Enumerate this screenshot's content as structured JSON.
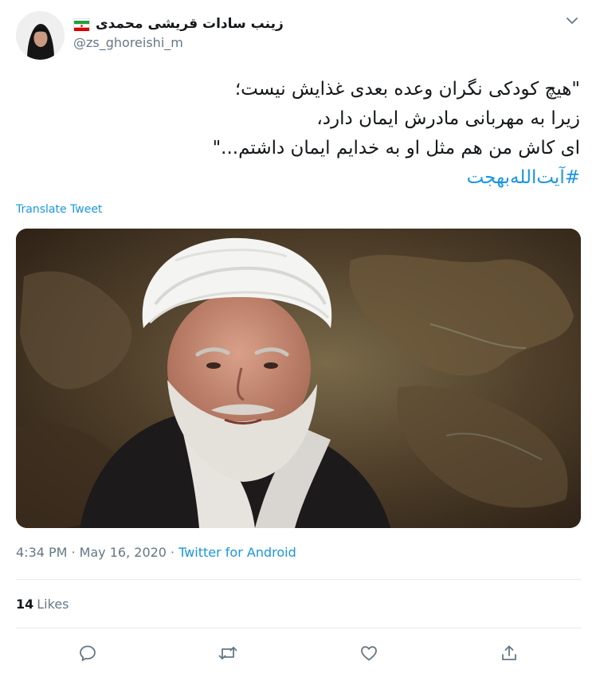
{
  "author": {
    "display_name": "زینب سادات قریشی محمدی",
    "handle": "@zs_ghoreishi_m",
    "flag_icon": "iran-flag-icon"
  },
  "tweet": {
    "lines": [
      "\"هیچ کودکی نگران وعده بعدی غذایش نیست؛",
      "زیرا به مهربانی مادرش ایمان دارد،",
      "ای کاش من هم مثل او به خدایم ایمان داشتم...\""
    ],
    "hashtag": "#آیت‌الله‌بهجت"
  },
  "translate_label": "Translate Tweet",
  "meta": {
    "time": "4:34 PM",
    "separator": "·",
    "date": "May 16, 2020",
    "source": "Twitter for Android"
  },
  "likes": {
    "count": "14",
    "label": "Likes"
  },
  "colors": {
    "link": "#1b95e0",
    "secondary_text": "#657786",
    "primary_text": "#14171a"
  }
}
